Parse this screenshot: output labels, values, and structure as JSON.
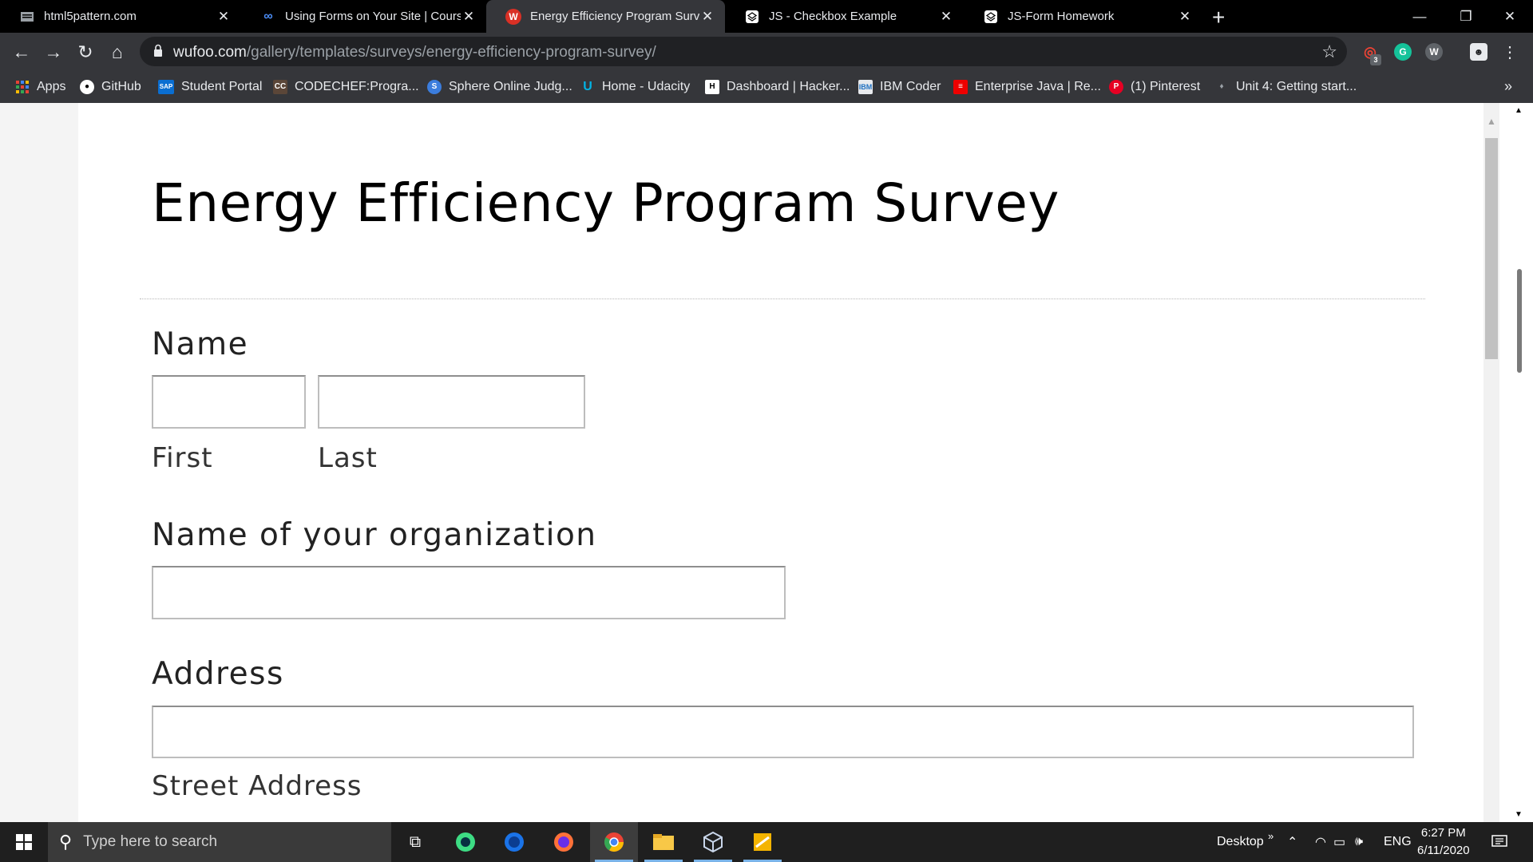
{
  "browser": {
    "tabs": [
      {
        "title": "html5pattern.com",
        "icon": "page-icon",
        "active": false
      },
      {
        "title": "Using Forms on Your Site | Coursera",
        "icon": "coursera-icon",
        "active": false
      },
      {
        "title": "Energy Efficiency Program Survey",
        "icon": "wufoo-icon",
        "active": true
      },
      {
        "title": "JS - Checkbox Example",
        "icon": "codepen-icon",
        "active": false
      },
      {
        "title": "JS-Form Homework",
        "icon": "codepen-icon",
        "active": false
      }
    ],
    "url_host": "wufoo.com",
    "url_path": "/gallery/templates/surveys/energy-efficiency-program-survey/",
    "extension_badge": "3",
    "bookmarks": [
      {
        "label": "Apps",
        "icon": "apps-grid-icon"
      },
      {
        "label": "GitHub",
        "icon": "github-icon"
      },
      {
        "label": "Student Portal",
        "icon": "sap-icon"
      },
      {
        "label": "CODECHEF:Progra...",
        "icon": "codechef-icon"
      },
      {
        "label": "Sphere Online Judg...",
        "icon": "spoj-icon"
      },
      {
        "label": "Home - Udacity",
        "icon": "udacity-icon"
      },
      {
        "label": "Dashboard | Hacker...",
        "icon": "hackerrank-icon"
      },
      {
        "label": "IBM Coder",
        "icon": "ibm-icon"
      },
      {
        "label": "Enterprise Java | Re...",
        "icon": "redhat-icon"
      },
      {
        "label": "(1) Pinterest",
        "icon": "pinterest-icon"
      },
      {
        "label": "Unit 4: Getting start...",
        "icon": "page-icon"
      }
    ]
  },
  "form": {
    "title": "Energy Efficiency Program Survey",
    "name_label": "Name",
    "first_label": "First",
    "last_label": "Last",
    "org_label": "Name of your organization",
    "address_label": "Address",
    "street_label": "Street Address"
  },
  "taskbar": {
    "search_placeholder": "Type here to search",
    "desktop_label": "Desktop",
    "language": "ENG",
    "time": "6:27 PM",
    "date": "6/11/2020"
  }
}
